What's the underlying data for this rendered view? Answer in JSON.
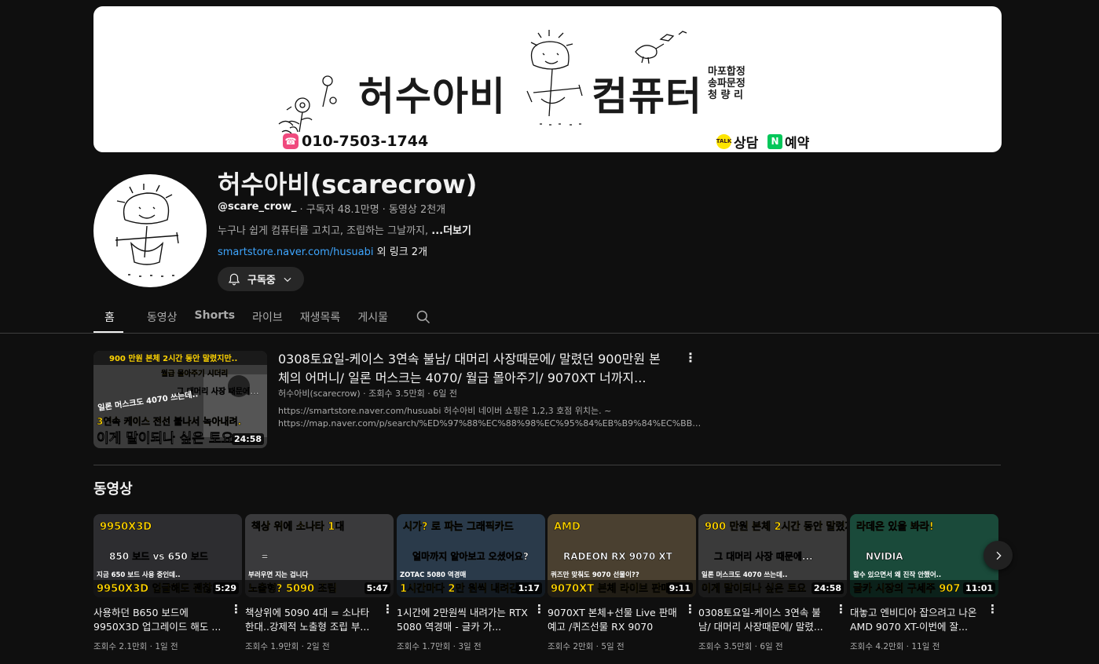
{
  "banner": {
    "title_left": "허수아비",
    "title_right": "컴퓨터",
    "branches": [
      "마포합정",
      "송파문정",
      "청 량 리"
    ],
    "phone": "010-7503-1744",
    "kakao_label": "상담",
    "kakao_icon_text": "TALK",
    "naver_label": "예약",
    "naver_icon_text": "N"
  },
  "channel": {
    "name": "허수아비(scarecrow)",
    "handle": "@scare_crow_",
    "subscribers": "· 구독자 48.1만명",
    "videos": "· 동영상 2천개",
    "description": "누구나 쉽게 컴퓨터를 고치고, 조립하는 그날까지,",
    "more": "...더보기",
    "link_url": "smartstore.naver.com/husuabi",
    "link_extra": "외 링크 2개",
    "subscribe_label": "구독중"
  },
  "tabs": [
    {
      "label": "홈"
    },
    {
      "label": "동영상"
    },
    {
      "label": "Shorts"
    },
    {
      "label": "라이브"
    },
    {
      "label": "재생목록"
    },
    {
      "label": "게시물"
    }
  ],
  "featured": {
    "title": "0308토요일-케이스 3연속 불남/ 대머리 사장때문에/ 말렸던 900만원 본체의 어머니/ 일론 머스크는 4070/ 월급 몰아주기/ 9070XT 너까지...",
    "meta": "허수아비(scarecrow) · 조회수 3.5만회 · 6일 전",
    "desc_line1": "https://smartstore.naver.com/husuabi 허수아비 네이버 쇼핑은 1,2,3 호점 위치는. ~",
    "desc_line2": "https://map.naver.com/p/search/%ED%97%88%EC%88%98%EC%95%84%EB%B9%84%EC%BB%B4%ED%93%A8...",
    "duration": "24:58",
    "thumb_text": [
      "900 만원 본체 2시간 동안 말렸지만..",
      "월급 몰아주기 시더리",
      "그 대머리 사장 때문에...",
      "일론 머스크도 4070 쓰는데..",
      "3연속 케이스 전선 불나서 녹아내려.",
      "이게 말이되나 싶은 토요"
    ]
  },
  "section_title": "동영상",
  "videos": [
    {
      "title": "사용하던 B650 보드에 9950X3D 업그레이드 해도 ...",
      "views": "조회수 2.1만회",
      "age": "1일 전",
      "duration": "5:29",
      "thumb_top": "9950X3D",
      "thumb_mid": "850 보드 vs 650 보드",
      "thumb_small": "지금 650 보드 사용 중인데..",
      "thumb_bottom": "9950X3D 업글해도 괜찮",
      "bg": "#2d2d30"
    },
    {
      "title": "책상위에 5090 4대 = 소나타 한대..강제적 노출형 조립 부...",
      "views": "조회수 1.9만회",
      "age": "2일 전",
      "duration": "5:47",
      "thumb_top": "책상 위에 소나타 1대",
      "thumb_mid": "=",
      "thumb_small": "부러우면 지는 겁니다",
      "thumb_bottom": "노출형? 5090 조립",
      "bg": "#3a3a3c"
    },
    {
      "title": "1시간에 2만원씩 내려가는 RTX 5080 역경매 - 글카 가...",
      "views": "조회수 1.7만회",
      "age": "3일 전",
      "duration": "1:17",
      "thumb_top": "시가? 로 파는 그래픽카드",
      "thumb_mid": "얼마까지 알아보고 오셨어요?",
      "thumb_small": "ZOTAC 5080 역경매",
      "thumb_bottom": "1시간마다 2만 원씩 내려감",
      "bg": "#2a3a4a"
    },
    {
      "title": "9070XT 본체+선물 Live 판매 예고 /퀴즈선물 RX 9070 +파...",
      "views": "조회수 2만회",
      "age": "5일 전",
      "duration": "9:11",
      "thumb_top": "AMD",
      "thumb_mid": "RADEON RX 9070 XT",
      "thumb_small": "퀴즈만 맞춰도 9070 선물이??",
      "thumb_bottom": "9070XT 본체 라이브 판매",
      "bg": "#4a4030"
    },
    {
      "title": "0308토요일-케이스 3연속 불남/ 대머리 사장때문에/ 말렸...",
      "views": "조회수 3.5만회",
      "age": "6일 전",
      "duration": "24:58",
      "thumb_top": "900 만원 본체 2시간 동안 말렸지만..",
      "thumb_mid": "그 대머리 사장 때문에...",
      "thumb_small": "일론 머스크도 4070 쓰는데..",
      "thumb_bottom": "이게 말이되나 싶은 토요",
      "bg": "#3a3a3a"
    },
    {
      "title": "대놓고 엔비디아 잡으려고 나온 AMD 9070 XT-이번에 잘...",
      "views": "조회수 4.2만회",
      "age": "11일 전",
      "duration": "11:01",
      "thumb_top": "라데온 있을 봐라!",
      "thumb_mid": "NVIDIA",
      "thumb_small": "할수 있으면서 왜 진작 안했어..",
      "thumb_bottom": "글카 시장의 구세주 907",
      "bg": "#1a4a3a"
    }
  ],
  "colors": {
    "accent_link": "#3ea6ff",
    "thumb_yellow": "#ffd400",
    "thumb_red": "#e02020"
  }
}
